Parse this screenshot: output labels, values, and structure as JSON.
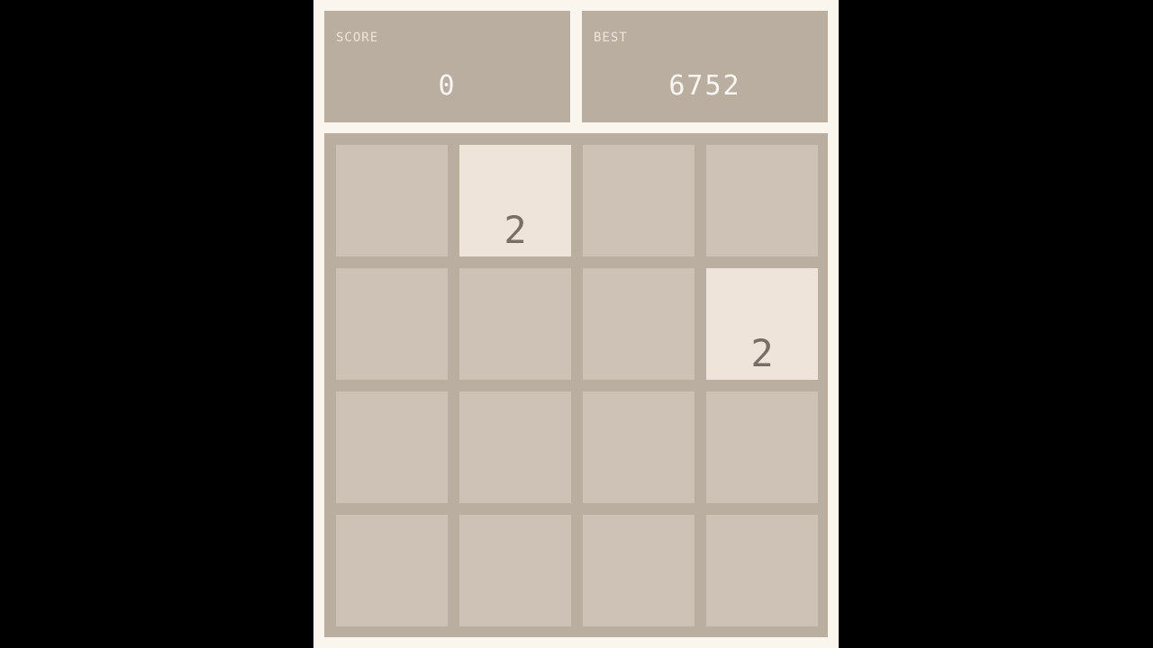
{
  "score": {
    "label": "SCORE",
    "value": "0"
  },
  "best": {
    "label": "BEST",
    "value": "6752"
  },
  "board": {
    "rows": [
      [
        "",
        "2",
        "",
        ""
      ],
      [
        "",
        "",
        "",
        "2"
      ],
      [
        "",
        "",
        "",
        ""
      ],
      [
        "",
        "",
        "",
        ""
      ]
    ]
  },
  "colors": {
    "background": "#000000",
    "panel": "#faf6ee",
    "board": "#baaea1",
    "empty_cell": "#cec2b6",
    "tile_2": "#eee4da",
    "tile_text": "#776e65",
    "score_text": "#f9f6f2"
  }
}
